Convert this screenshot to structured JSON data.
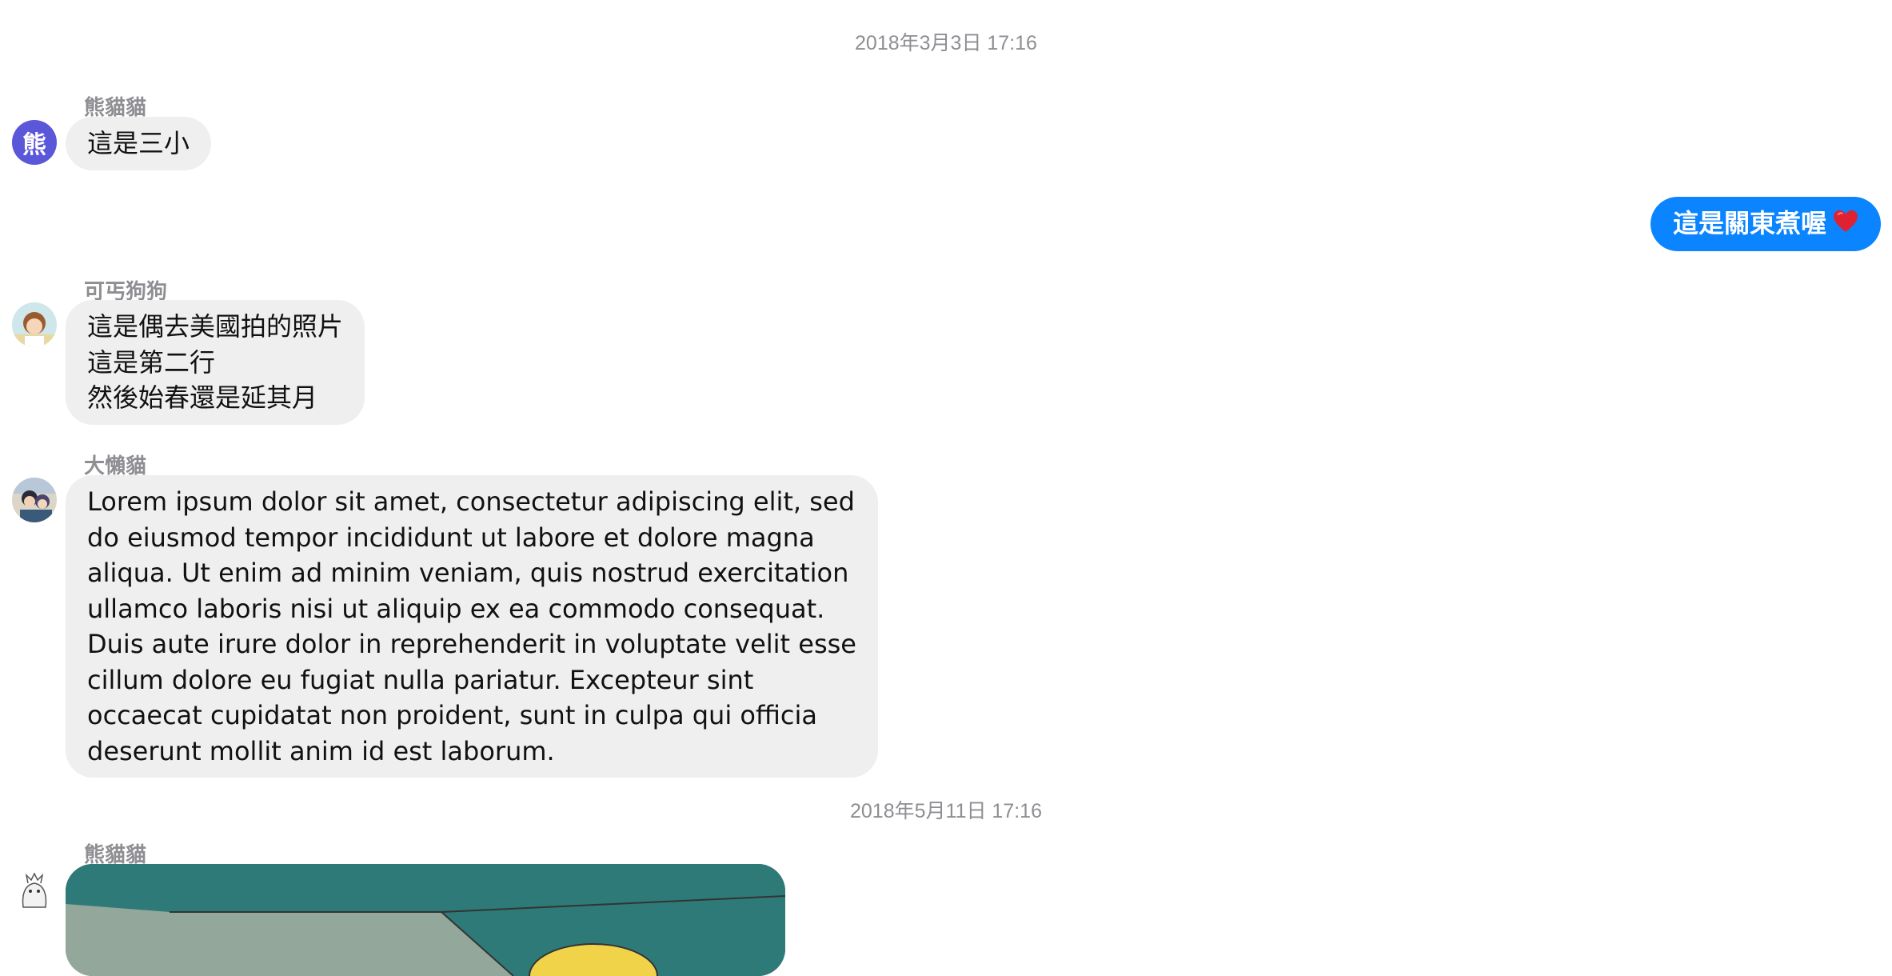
{
  "messages": {
    "timestamp_1": "2018年3月3日 17:16",
    "m1": {
      "sender": "熊貓貓",
      "avatar_char": "熊",
      "text": "這是三小"
    },
    "m2": {
      "text": "這是關東煮喔",
      "emoji": "heart-emoji"
    },
    "m3": {
      "sender": "可丐狗狗",
      "lines": [
        "這是偶去美國拍的照片",
        "這是第二行",
        "然後始春還是延其月"
      ]
    },
    "m4": {
      "sender": "大懶貓",
      "lines": [
        "Lorem ipsum dolor sit amet, consectetur adipiscing elit, sed",
        "do eiusmod tempor incididunt ut labore et dolore magna",
        "aliqua. Ut enim ad minim veniam, quis nostrud exercitation",
        "ullamco laboris nisi ut aliquip ex ea commodo consequat.",
        "Duis aute irure dolor in reprehenderit in voluptate velit esse",
        "cillum dolore eu fugiat nulla pariatur. Excepteur sint",
        "occaecat cupidatat non proident, sunt in culpa qui officia",
        "deserunt mollit anim id est laborum."
      ]
    },
    "timestamp_2": "2018年5月11日 17:16",
    "m5": {
      "sender": "熊貓貓",
      "attachment": "image"
    }
  },
  "colors": {
    "outgoing_bubble": "#0a84ff",
    "incoming_bubble": "#efefef",
    "meta_text": "#8e8e93",
    "avatar_bg": "#5a57d9"
  }
}
